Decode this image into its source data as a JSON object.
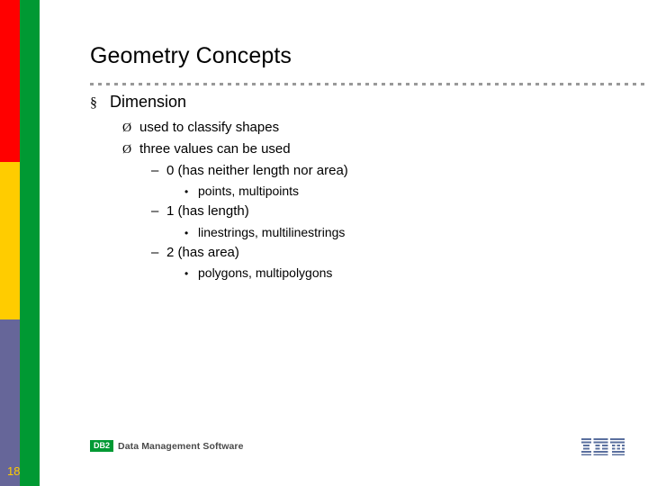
{
  "slide": {
    "title": "Geometry Concepts",
    "page_number": "18",
    "bullets": {
      "l1_marker": "§",
      "l2_marker": "Ø",
      "l3_marker": "–",
      "l4_marker": "•"
    },
    "content": [
      {
        "level": 1,
        "text": "Dimension"
      },
      {
        "level": 2,
        "text": "used to classify shapes"
      },
      {
        "level": 2,
        "text": "three values can be used"
      },
      {
        "level": 3,
        "text": "0 (has neither length nor area)"
      },
      {
        "level": 4,
        "text": "points, multipoints"
      },
      {
        "level": 3,
        "text": "1 (has length)"
      },
      {
        "level": 4,
        "text": "linestrings, multilinestrings"
      },
      {
        "level": 3,
        "text": "2 (has area)"
      },
      {
        "level": 4,
        "text": "polygons, multipolygons"
      }
    ]
  },
  "footer": {
    "db2_badge": "DB2",
    "product_line": "Data Management Software",
    "brand": "IBM"
  },
  "colors": {
    "red_bar": "#ff0000",
    "yellow_bar": "#ffcc00",
    "purple_bar": "#666699",
    "green_bar": "#009933",
    "ibm_blue": "#5a6f9e"
  }
}
